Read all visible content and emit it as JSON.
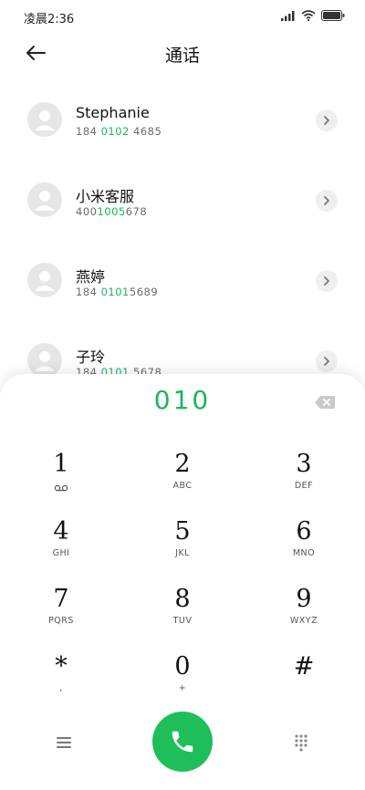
{
  "status": {
    "time": "凌晨2:36"
  },
  "header": {
    "title": "通话"
  },
  "contacts": [
    {
      "name": "Stephanie",
      "number_before": "184 ",
      "number_highlight": "0102",
      "number_after": " 4685"
    },
    {
      "name": "小米客服",
      "number_before": "400",
      "number_highlight": "1005",
      "number_after": "678"
    },
    {
      "name": "燕婷",
      "number_before": "184 ",
      "number_highlight": "0101",
      "number_after": "5689"
    },
    {
      "name": "子玲",
      "number_before": "184 ",
      "number_highlight": "0101",
      "number_after": " 5678"
    }
  ],
  "dialer": {
    "input": "010",
    "keys": [
      {
        "digit": "1",
        "letters": ""
      },
      {
        "digit": "2",
        "letters": "ABC"
      },
      {
        "digit": "3",
        "letters": "DEF"
      },
      {
        "digit": "4",
        "letters": "GHI"
      },
      {
        "digit": "5",
        "letters": "JKL"
      },
      {
        "digit": "6",
        "letters": "MNO"
      },
      {
        "digit": "7",
        "letters": "PQRS"
      },
      {
        "digit": "8",
        "letters": "TUV"
      },
      {
        "digit": "9",
        "letters": "WXYZ"
      },
      {
        "digit": "*",
        "letters": ","
      },
      {
        "digit": "0",
        "letters": "+"
      },
      {
        "digit": "#",
        "letters": ""
      }
    ]
  },
  "icons": {
    "back": "arrow-left-icon",
    "chevron": "chevron-right-icon",
    "backspace": "backspace-icon",
    "voicemail": "voicemail-icon",
    "menu": "menu-icon",
    "call": "phone-icon",
    "dialpad": "dialpad-icon"
  },
  "colors": {
    "accent": "#1fb45c",
    "call_button": "#1ebe5a"
  }
}
